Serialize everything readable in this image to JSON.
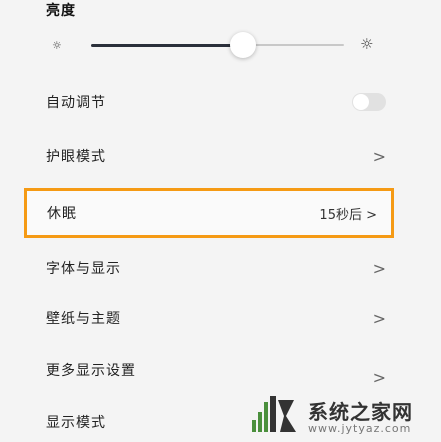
{
  "section_title": "亮度",
  "brightness": {
    "level": 0.6,
    "small_icon": "small-sun-icon",
    "large_icon": "large-sun-icon"
  },
  "settings": {
    "auto_adjust_label": "自动调节",
    "auto_adjust_on": false,
    "eye_comfort_label": "护眼模式",
    "sleep_label": "休眠",
    "sleep_value": "15秒后",
    "text_style_label": "字体与显示",
    "wallpaper_label": "壁纸与主题",
    "extra_label": "更多显示设置",
    "last_label": "显示模式"
  },
  "watermark": {
    "title": "系统之家网",
    "url": "www.jytyaz.com"
  },
  "colors": {
    "highlight": "#f59a14",
    "track": "#2a2f3a"
  }
}
